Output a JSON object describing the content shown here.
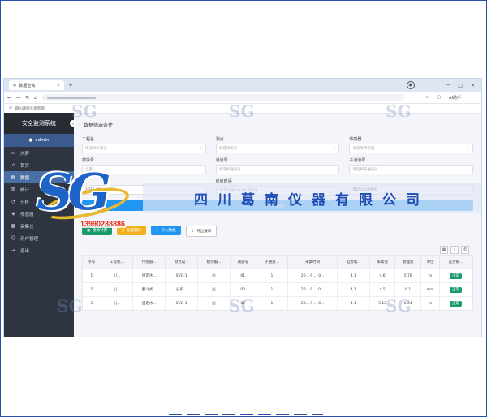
{
  "browser": {
    "tab_title": "数据查询",
    "tab_close": "×",
    "new_tab": "+",
    "bookmark": "四川葛南大坝监测",
    "copilot_label": "AI助手"
  },
  "sidebar": {
    "system_title": "安全监测系统",
    "user": "admin",
    "items": [
      {
        "label": "大屏",
        "icon": "monitor-icon"
      },
      {
        "label": "首页",
        "icon": "home-icon"
      },
      {
        "label": "数据",
        "icon": "database-icon",
        "active": true
      },
      {
        "label": "统计",
        "icon": "chart-icon"
      },
      {
        "label": "分析",
        "icon": "analysis-icon"
      },
      {
        "label": "传感器",
        "icon": "sensor-icon"
      },
      {
        "label": "采集仪",
        "icon": "collector-icon"
      },
      {
        "label": "用户管理",
        "icon": "users-icon"
      },
      {
        "label": "退出",
        "icon": "logout-icon"
      }
    ]
  },
  "filter": {
    "section_title": "数据筛选条件",
    "project_label": "工程名",
    "project_placeholder": "请选择工程名",
    "point_label": "测点",
    "point_placeholder": "请选择测点",
    "sensor_label": "传感器",
    "sensor_placeholder": "请选择传感器",
    "module_label": "模块号",
    "module_placeholder": "全部",
    "channel_label": "通道号",
    "channel_placeholder": "请选择通道号",
    "subchannel_label": "子通道号",
    "subchannel_placeholder": "请选择子通道号",
    "start_time": "2025-09-... 8:22",
    "end_time_label": "结束时间",
    "end_time": "2025-09-16 09:58:22",
    "limit_value": "最近500条数据",
    "query_button": "查询"
  },
  "actions": {
    "recalc": "重新计算",
    "batch_delete": "批量删除",
    "import": "导入数据",
    "export": "导出报表"
  },
  "table": {
    "headers": [
      "序号",
      "工程机...",
      "传感器...",
      "测点设...",
      "模块编...",
      "通道号",
      "子通道...",
      "采集时间",
      "电池电...",
      "采集值",
      "物理量",
      "单位",
      "是否被..."
    ],
    "rows": [
      [
        "1",
        "|||...",
        "固定水...",
        "SVG-1",
        "|||",
        "01",
        "1",
        "20... 9 ... 0...",
        "4.1",
        "4.6",
        "5.78",
        "m",
        "正常"
      ],
      [
        "2",
        "|||...",
        "翻斗式...",
        "分段...",
        "|||",
        "00",
        "1",
        "20... 9 ... 0...",
        "4.1",
        "4.5",
        "6.1",
        "mm",
        "正常"
      ],
      [
        "3",
        "|||...",
        "固定水...",
        "SVG-1",
        "|||",
        "01",
        "1",
        "20... 9 ... 0...",
        "4.1",
        "3.12",
        "6.24",
        "m",
        "正常"
      ]
    ]
  },
  "watermark": {
    "logo_letters": "SG",
    "phone": "13990288886",
    "company": "四川葛南仪器有限公司"
  }
}
